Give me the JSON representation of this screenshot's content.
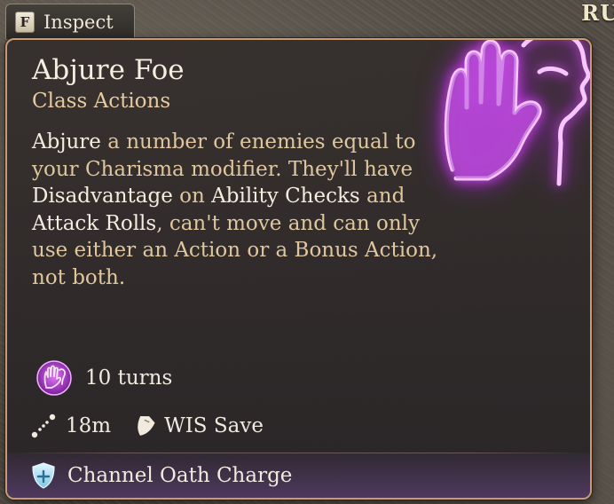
{
  "background": {
    "corner_text": "RU"
  },
  "inspect_tab": {
    "key": "F",
    "label": "Inspect"
  },
  "tooltip": {
    "title": "Abjure Foe",
    "subtitle": "Class Actions",
    "description": {
      "p1": "Abjure",
      "p2": " a number of enemies equal to your Charisma modifier. They'll have ",
      "p3": "Disadvantage",
      "p4": " on ",
      "p5": "Ability Checks",
      "p6": " and ",
      "p7": "Attack Rolls",
      "p8": ", can't move and can only use either an Action or a Bonus Action, not both."
    },
    "duration": {
      "icon": "abjure-palm-icon",
      "text": "10 turns"
    },
    "range": {
      "icon": "range-ruler-icon",
      "text": "18m"
    },
    "save": {
      "icon": "shield-save-icon",
      "text": "WIS Save"
    },
    "resource": {
      "icon": "channel-oath-shield-icon",
      "text": "Channel Oath Charge"
    }
  },
  "colors": {
    "keyword": "#f3ece0",
    "body_text": "#dfc69c",
    "subtitle": "#e8c9a0",
    "border": "#c99a74",
    "glow": "#d04cf2"
  }
}
